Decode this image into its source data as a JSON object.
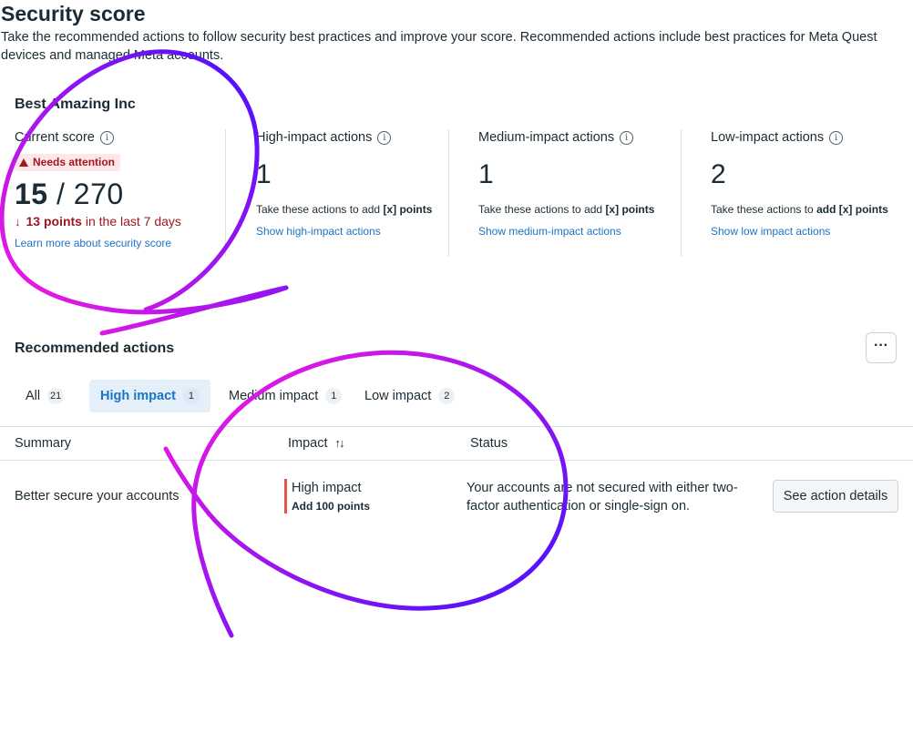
{
  "page": {
    "title": "Security score",
    "description": "Take the recommended actions to follow security best practices and improve your score. Recommended actions include best practices for Meta Quest devices and managed Meta accounts."
  },
  "company": {
    "name": "Best Amazing Inc"
  },
  "current_score": {
    "label": "Current score",
    "badge": "Needs attention",
    "score": "15",
    "separator": "/",
    "total": "270",
    "change_points": "13 points",
    "change_suffix": "in the last 7 days",
    "learn_more": "Learn more about security score"
  },
  "metrics": [
    {
      "label": "High-impact actions",
      "count": "1",
      "desc_prefix": "Take these actions to add",
      "desc_bold": "[x] points",
      "link": "Show high-impact actions"
    },
    {
      "label": "Medium-impact actions",
      "count": "1",
      "desc_prefix": "Take these actions to add",
      "desc_bold": "[x] points",
      "link": "Show medium-impact actions"
    },
    {
      "label": "Low-impact actions",
      "count": "2",
      "desc_prefix": "Take these actions to",
      "desc_bold": "add [x] points",
      "link": "Show low impact actions"
    }
  ],
  "recommended": {
    "title": "Recommended actions",
    "more_label": "···",
    "tabs": [
      {
        "label": "All",
        "count": "21"
      },
      {
        "label": "High impact",
        "count": "1"
      },
      {
        "label": "Medium impact",
        "count": "1"
      },
      {
        "label": "Low impact",
        "count": "2"
      }
    ],
    "columns": {
      "summary": "Summary",
      "impact": "Impact",
      "sort_glyph": "↑↓",
      "status": "Status"
    },
    "rows": [
      {
        "summary": "Better secure your accounts",
        "impact": "High impact",
        "points": "Add 100 points",
        "status": "Your accounts are not secured with either two-factor authentication or single-sign on.",
        "action": "See action details"
      }
    ]
  },
  "colors": {
    "accent": "#1b74c5",
    "danger": "#a11721",
    "impact_high": "#e0574a",
    "annotation_start": "#ff1adf",
    "annotation_end": "#3a10ff"
  }
}
